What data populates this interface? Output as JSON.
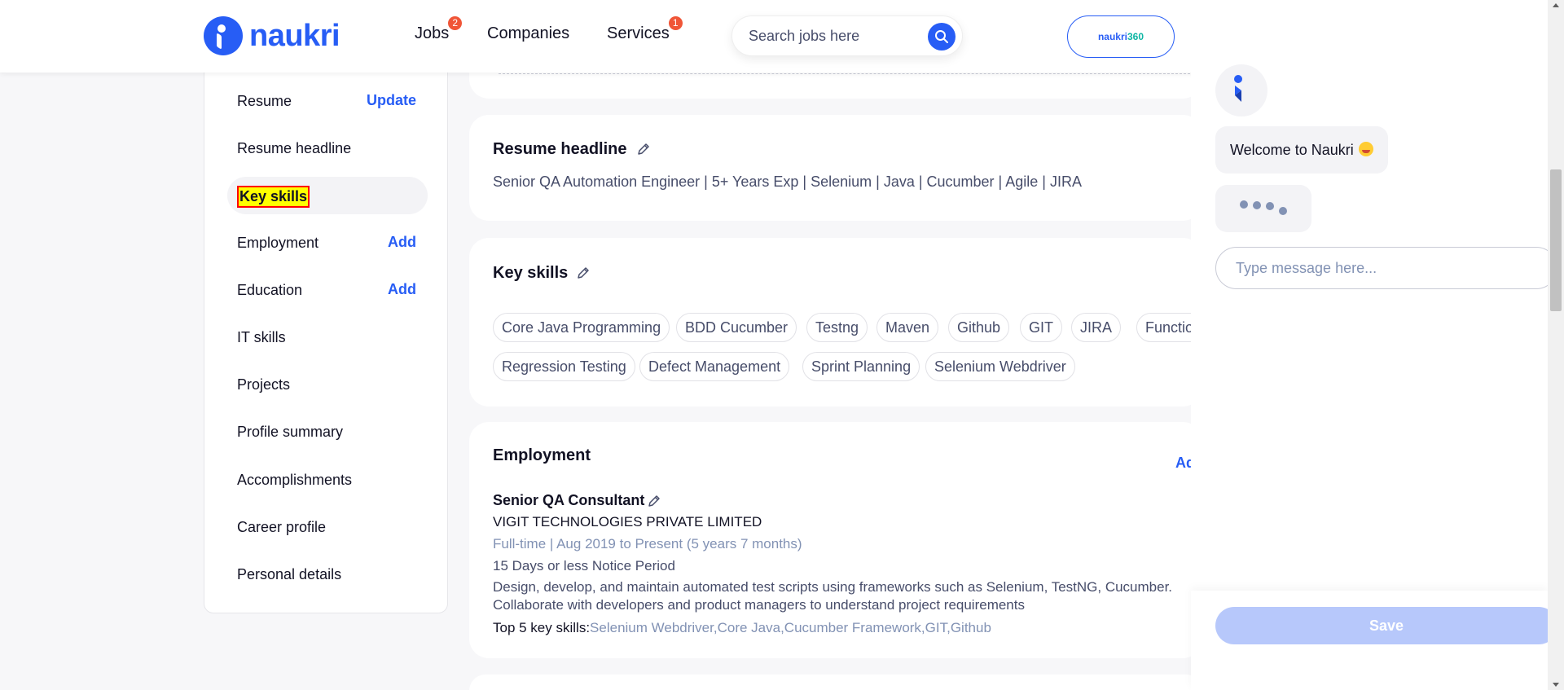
{
  "header": {
    "logo_text": "naukri",
    "nav": [
      {
        "label": "Jobs",
        "badge": "2"
      },
      {
        "label": "Companies"
      },
      {
        "label": "Services",
        "badge": "1"
      }
    ],
    "search_placeholder": "Search jobs here",
    "naukri360_prefix": "naukri",
    "naukri360_suffix": "360"
  },
  "sidebar": {
    "items": [
      {
        "label": "Resume",
        "action": "Update"
      },
      {
        "label": "Resume headline"
      },
      {
        "label": "Key skills",
        "active": true
      },
      {
        "label": "Employment",
        "action": "Add"
      },
      {
        "label": "Education",
        "action": "Add"
      },
      {
        "label": "IT skills"
      },
      {
        "label": "Projects"
      },
      {
        "label": "Profile summary"
      },
      {
        "label": "Accomplishments"
      },
      {
        "label": "Career profile"
      },
      {
        "label": "Personal details"
      }
    ]
  },
  "resume_headline": {
    "title": "Resume headline",
    "text": "Senior QA Automation Engineer | 5+ Years Exp | Selenium | Java | Cucumber | Agile | JIRA"
  },
  "key_skills": {
    "title": "Key skills",
    "chips": [
      "Core Java Programming",
      "BDD Cucumber",
      "Testng",
      "Maven",
      "Github",
      "GIT",
      "JIRA",
      "Functional Testing",
      "Regression Testing",
      "Defect Management",
      "Sprint Planning",
      "Selenium Webdriver"
    ]
  },
  "employment": {
    "title": "Employment",
    "add_label": "Add",
    "role": "Senior QA Consultant",
    "company": "VIGIT TECHNOLOGIES PRIVATE LIMITED",
    "meta": "Full-time | Aug 2019 to Present (5 years 7 months)",
    "notice": "15 Days or less Notice Period",
    "description": "Design, develop, and maintain automated test scripts using frameworks such as Selenium, TestNG, Cucumber. Collaborate with developers and product managers to understand project requirements",
    "skills_label": "Top 5 key skills:",
    "skills_values": "Selenium Webdriver,Core Java,Cucumber Framework,GIT,Github"
  },
  "chat": {
    "welcome": "Welcome to Naukri",
    "input_placeholder": "Type message here...",
    "save_label": "Save"
  },
  "colors": {
    "brand": "#275df5",
    "badge": "#f05537",
    "highlight": "#ffff00"
  }
}
